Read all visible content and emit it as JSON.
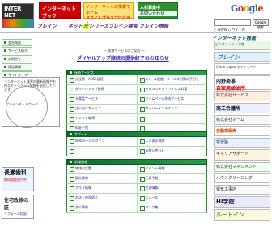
{
  "header": {
    "logo_text": "INTER NET",
    "banner_red": {
      "title": "インターネットブック",
      "sub": "安全インターネットの作り方"
    },
    "banner_orange": {
      "title": "インターネットの情報でホーム",
      "sub": "スマイルプラスプログラム"
    },
    "banner_green": {
      "title": "人材募集中",
      "sub": "お問い合わせ"
    },
    "google": {
      "b1": "G",
      "r1": "o",
      "y": "o",
      "b2": "g",
      "g": "l",
      "r2": "e"
    },
    "search_placeholder": "",
    "search_button": "Google 検索",
    "search_options": "○ WWW  ○ サイト内",
    "nav": [
      {
        "label": "ブレイン"
      },
      {
        "pre": "ネット",
        "hl": "光",
        "post": "シリーズ"
      },
      {
        "label": "ブレイン検索"
      },
      {
        "label": "ブレイン情報"
      }
    ]
  },
  "sidebar": {
    "items": [
      "会社概要",
      "サービス紹介",
      "お問合せ",
      "採用情報",
      "サイトマップ"
    ],
    "notice": "インターネット業界の最新情報やお得なキャンペーン情報を配信しています。",
    "emblem_text": "ブレインネットワーク"
  },
  "ads_left": {
    "nagase": {
      "title": "長瀬歯科",
      "sub": "無料相談受付中"
    },
    "takumi": {
      "title": "住宅改修の匠",
      "sub": "リフォーム相談"
    }
  },
  "main": {
    "notice_label": "― 各種サービスのご案内 ―",
    "notice_link": "ダイヤルアップ接続の提供終了のお知らせ",
    "grid1": {
      "header": "接続サービス",
      "rows": [
        [
          "光接続・ADSL接続",
          "eメール設定・ウイルス対策の手引き"
        ],
        [
          "ダイヤルアップ接続",
          "セキュリティ・ウイルス対策"
        ],
        [
          "光電話サービス",
          "ホームページ作成サービス"
        ],
        [
          "法人向けサービス",
          "サーバーメンテナンス"
        ],
        [
          "ドメイン取得",
          ""
        ],
        [
          "料金一覧",
          ""
        ]
      ]
    },
    "grid2": {
      "header": "サポート",
      "rows": [
        [
          "Webメールログイン",
          "よくある質問"
        ],
        [
          "",
          "お問い合わせ"
        ]
      ]
    },
    "grid3": {
      "header": "地域情報",
      "rows": [
        [
          "地域の話題",
          "イベント情報"
        ],
        [
          "観光情報",
          "天気予報"
        ],
        [
          "グルメ情報",
          "交通情報"
        ],
        [
          "お店・施設紹介",
          "ニュース"
        ],
        [
          "求人情報",
          "リンク集"
        ]
      ]
    }
  },
  "right_col": {
    "title": "インターネット推進",
    "bizlink": "ビジネス・リンク集",
    "brain": "ブレイン",
    "cyber": "Cyber Japan ネットワーク",
    "uchino_a": "内野商事",
    "uchino_b": "自家用給油所",
    "ad1": "株式会社サービス",
    "ad2": "商工会議所",
    "ad3": "株式会社ホーム",
    "ad4": "自動車販売",
    "ad5": "学習塾",
    "ad6": "キャリアサポート",
    "ad7": "株式会社マネジメント",
    "ad8": "ハウスクリーニング",
    "ad9": "電気工事店",
    "ad10": "HI学院",
    "ad11": "ルートイン"
  }
}
